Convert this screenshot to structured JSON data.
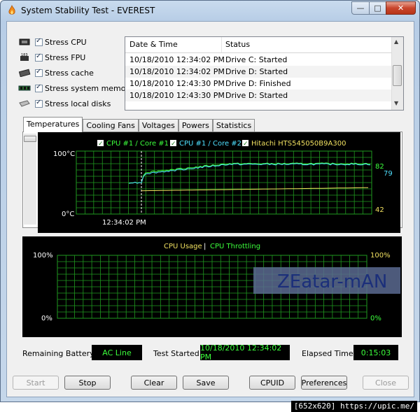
{
  "window": {
    "title": "System Stability Test - EVEREST",
    "min_glyph": "—",
    "max_glyph": "□",
    "close_glyph": "✕"
  },
  "stress": [
    {
      "label": "Stress CPU",
      "icon": "cpu-chip-icon",
      "checked": true
    },
    {
      "label": "Stress FPU",
      "icon": "fpu-chip-icon",
      "checked": true
    },
    {
      "label": "Stress cache",
      "icon": "cache-chip-icon",
      "checked": true
    },
    {
      "label": "Stress system memory",
      "icon": "memory-module-icon",
      "checked": true
    },
    {
      "label": "Stress local disks",
      "icon": "hard-disk-icon",
      "checked": true
    }
  ],
  "log": {
    "headers": {
      "date": "Date & Time",
      "status": "Status"
    },
    "rows": [
      {
        "date": "10/18/2010 12:34:02 PM",
        "status": "Drive C: Started"
      },
      {
        "date": "10/18/2010 12:34:02 PM",
        "status": "Drive D: Started"
      },
      {
        "date": "10/18/2010 12:43:30 PM",
        "status": "Drive D: Finished"
      },
      {
        "date": "10/18/2010 12:43:30 PM",
        "status": "Drive D: Started"
      }
    ]
  },
  "tabs": [
    "Temperatures",
    "Cooling Fans",
    "Voltages",
    "Powers",
    "Statistics"
  ],
  "temp_chart": {
    "legend": [
      {
        "label": "CPU #1 / Core #1",
        "color": "#3cff3c"
      },
      {
        "label": "CPU #1 / Core #2",
        "color": "#4fe0ff"
      },
      {
        "label": "Hitachi HTS545050B9A300",
        "color": "#f0e060"
      }
    ],
    "y_top_label": "100°C",
    "y_bottom_label": "0°C",
    "marker_time": "12:34:02 PM",
    "readings": {
      "core1": "82",
      "core2": "79",
      "disk": "42"
    }
  },
  "cpu_chart": {
    "legend_usage": "CPU Usage",
    "legend_sep": "|",
    "legend_throttle": "CPU Throttling",
    "left_top": "100%",
    "left_bottom": "0%",
    "right_top": "100%",
    "right_bottom": "0%",
    "watermark": "ZEatar-mAN"
  },
  "status": {
    "battery_label": "Remaining Battery:",
    "battery_value": "AC Line",
    "started_label": "Test Started:",
    "started_value": "10/18/2010 12:34:02 PM",
    "elapsed_label": "Elapsed Time:",
    "elapsed_value": "0:15:03"
  },
  "buttons": {
    "start": "Start",
    "stop": "Stop",
    "clear": "Clear",
    "save": "Save",
    "cpuid": "CPUID",
    "preferences": "Preferences",
    "close": "Close"
  },
  "credit": "[652x620] https://upic.me/",
  "colors": {
    "grid": "#1f9a1f",
    "graph_bg": "#000000",
    "status_text": "#3cff3c"
  }
}
